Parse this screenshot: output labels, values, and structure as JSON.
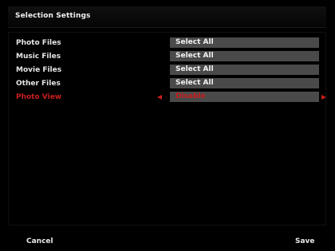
{
  "title": "Selection Settings",
  "rows": [
    {
      "label": "Photo Files",
      "value": "Select All"
    },
    {
      "label": "Music Files",
      "value": "Select All"
    },
    {
      "label": "Movie Files",
      "value": "Select All"
    },
    {
      "label": "Other Files",
      "value": "Select All"
    },
    {
      "label": "Photo View",
      "value": "Disable"
    }
  ],
  "footer": {
    "cancel_label": "Cancel",
    "save_label": "Save"
  },
  "colors": {
    "active": "#c81e1e",
    "value_box": "#4a4a4a"
  }
}
